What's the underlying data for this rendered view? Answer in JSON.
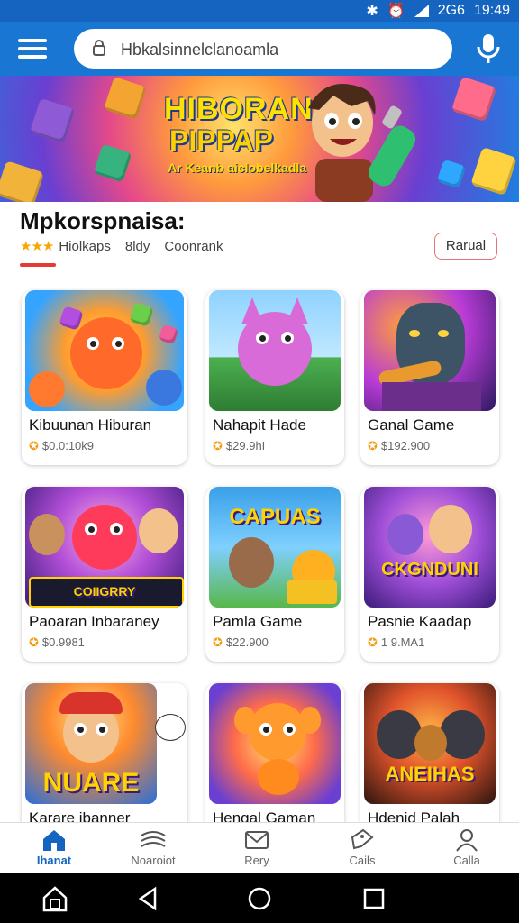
{
  "status_bar": {
    "network": "2G6",
    "time": "19:49"
  },
  "search": {
    "value": "Hbkalsinnelclanoamla"
  },
  "banner": {
    "title_line1": "HIBORAN",
    "title_line2": "PIPPAP",
    "subtitle": "Ar Keanb aiclobelkadla"
  },
  "app": {
    "title": "Mpkorspnaisa:",
    "rating_stars": "★★★",
    "meta1": "Hiolkaps",
    "meta2": "8ldy",
    "meta3": "Coonrank",
    "install_label": "Rarual"
  },
  "games": [
    {
      "name": "Kibuunan Hiburan",
      "price": "$0.0:10k9",
      "thumb_text": ""
    },
    {
      "name": "Nahapit Hade",
      "price": "$29.9hI",
      "thumb_text": ""
    },
    {
      "name": "Ganal Game",
      "price": "$192.900",
      "thumb_text": ""
    },
    {
      "name": "Paoaran Inbaraney",
      "price": "$0.9981",
      "thumb_text": "COIIGRRY"
    },
    {
      "name": "Pamla Game",
      "price": "$22.900",
      "thumb_text": "CAPUAS"
    },
    {
      "name": "Pasnie Kaadap",
      "price": "1 9.MA1",
      "thumb_text": "CKGNDUNI"
    },
    {
      "name": "Karare ibanner",
      "price": "",
      "thumb_text": "NUARE"
    },
    {
      "name": "Hengal Gaman",
      "price": "",
      "thumb_text": ""
    },
    {
      "name": "Hdenid Palah",
      "price": "",
      "thumb_text": "ANEIHAS"
    }
  ],
  "bottom_nav": [
    {
      "label": "Ihanat",
      "icon": "home-icon"
    },
    {
      "label": "Noaroiot",
      "icon": "layers-icon"
    },
    {
      "label": "Rery",
      "icon": "mail-icon"
    },
    {
      "label": "Cails",
      "icon": "tag-icon"
    },
    {
      "label": "Calla",
      "icon": "person-icon"
    }
  ],
  "colors": {
    "primary": "#1976d2",
    "status": "#1565c0",
    "accent": "#e53935",
    "star": "#f6a800"
  }
}
